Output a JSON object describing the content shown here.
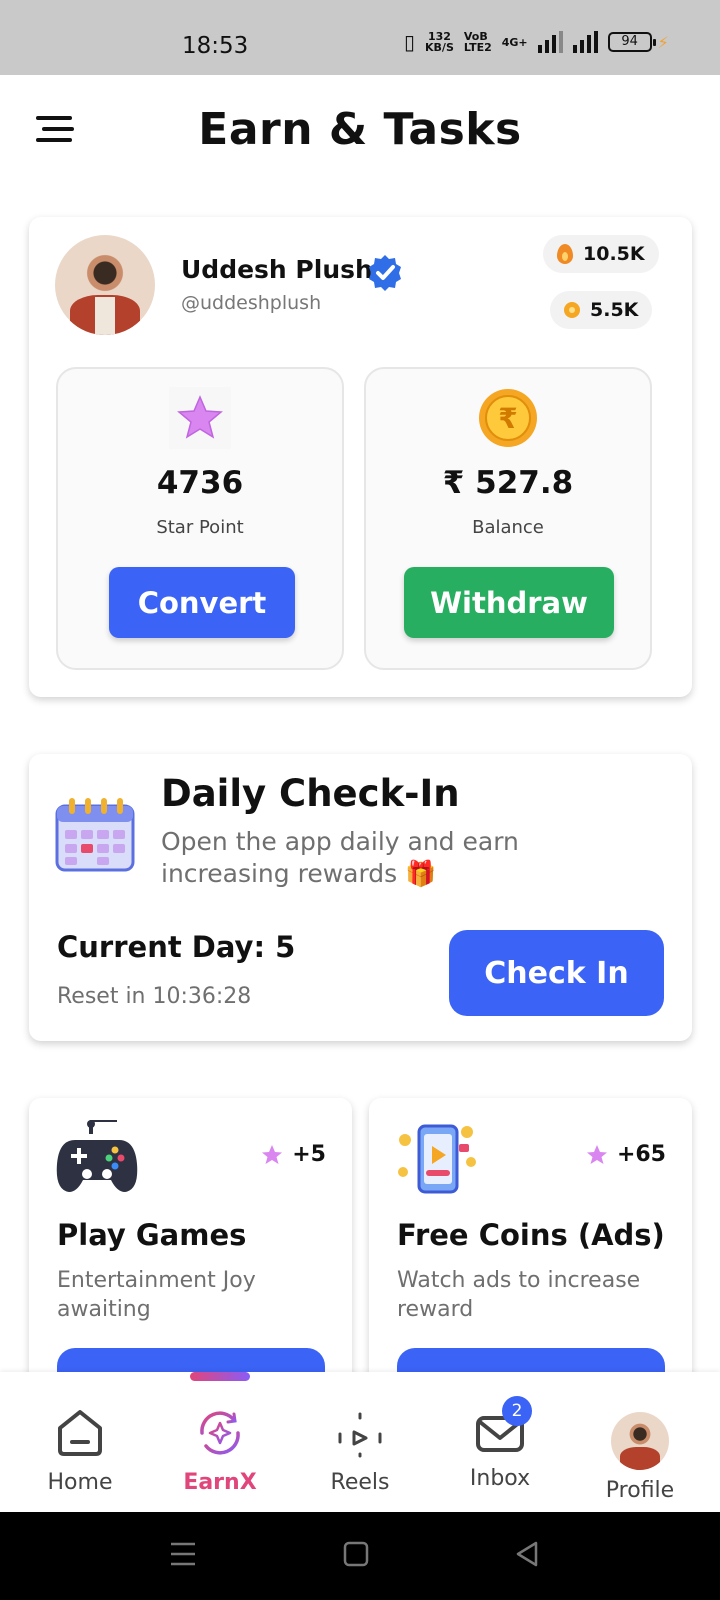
{
  "status_bar": {
    "time": "18:53",
    "speed_value": "132",
    "speed_unit": "KB/S",
    "volte_top": "VoB",
    "volte_bottom": "LTE2",
    "network": "4G+",
    "battery": "94"
  },
  "header": {
    "title": "Earn & Tasks"
  },
  "profile": {
    "name": "Uddesh Plush",
    "handle": "@uddeshplush",
    "fire_count": "10.5K",
    "coin_count": "5.5K"
  },
  "stats": {
    "star": {
      "value": "4736",
      "label": "Star Point",
      "button": "Convert"
    },
    "balance": {
      "value": "₹ 527.8",
      "label": "Balance",
      "button": "Withdraw"
    }
  },
  "daily_checkin": {
    "title": "Daily Check-In",
    "subtitle": "Open the app daily and earn increasing rewards 🎁",
    "current_day": "Current Day: 5",
    "reset": "Reset in 10:36:28",
    "button": "Check In"
  },
  "tasks": [
    {
      "title": "Play Games",
      "description": "Entertainment Joy awaiting",
      "reward": "+5"
    },
    {
      "title": "Free Coins (Ads)",
      "description": "Watch ads to increase reward",
      "reward": "+65"
    }
  ],
  "bottom_nav": {
    "items": [
      {
        "label": "Home"
      },
      {
        "label": "EarnX"
      },
      {
        "label": "Reels"
      },
      {
        "label": "Inbox",
        "badge": "2"
      },
      {
        "label": "Profile"
      }
    ],
    "active": "EarnX",
    "active_color": "#e0457b"
  },
  "colors": {
    "primary_blue": "#3b63f6",
    "withdraw_green": "#27ae60"
  }
}
